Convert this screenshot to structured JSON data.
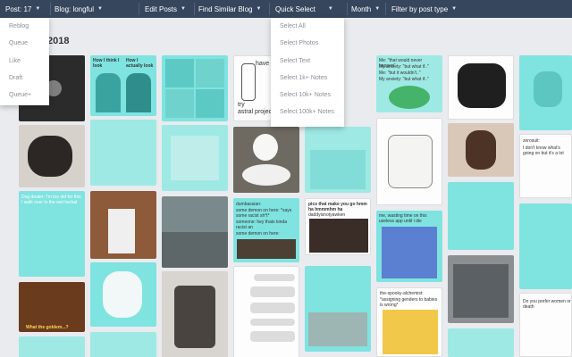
{
  "toolbar": {
    "post_count": "Post: 17",
    "blog": "Blog: longful",
    "edit_posts": "Edit Posts",
    "find_similar": "Find Similar Blog",
    "quick_select": "Quick Select",
    "month": "Month",
    "filter": "Filter by post type"
  },
  "page": {
    "date_fragment": "2018"
  },
  "left_menu": {
    "items": [
      "Reblog",
      "Queue",
      "Like",
      "Draft",
      "Queue+"
    ]
  },
  "quick_select_menu": {
    "items": [
      "Select All",
      "Select Photos",
      "Select Text",
      "Select 1k+ Notes",
      "Select 10k+ Notes",
      "Select 100k+ Notes"
    ]
  },
  "captions": {
    "c1a": "How I think I look",
    "c1b": "How I actually look",
    "c2": "have y",
    "c3a": "try",
    "c3b": "astral project",
    "c4a": "Me: \"that would never happen\"",
    "c4b": "My anxiety: \"but what if..\"",
    "c4c": "Me: \"but it wouldn't..\"",
    "c4d": "My anxiety: \"but what if..\"",
    "c5": "Dog dealer: I'm too old for this I walk over to the wet herbal",
    "c6": "dumbassian:",
    "c7a": "some demon on here: *says some racist sh*t*",
    "c7b": "someone: hey thats kinda racist an",
    "c7c": "some demon on here:",
    "c8a": "pics that make you go hmm ha hmmmhm ha",
    "c8b": "daddyisnotyawken",
    "c9": "me, wasting time on this useless app until i die",
    "c10": "zerosuit:",
    "c11": "I don't know what's going on but it's a lot",
    "c12a": "the-spooky-alchemist:",
    "c12b": "*assigning genders to babies is wrong*",
    "c13": "Do you prefer women or death",
    "c14": "What the goblem...?"
  }
}
